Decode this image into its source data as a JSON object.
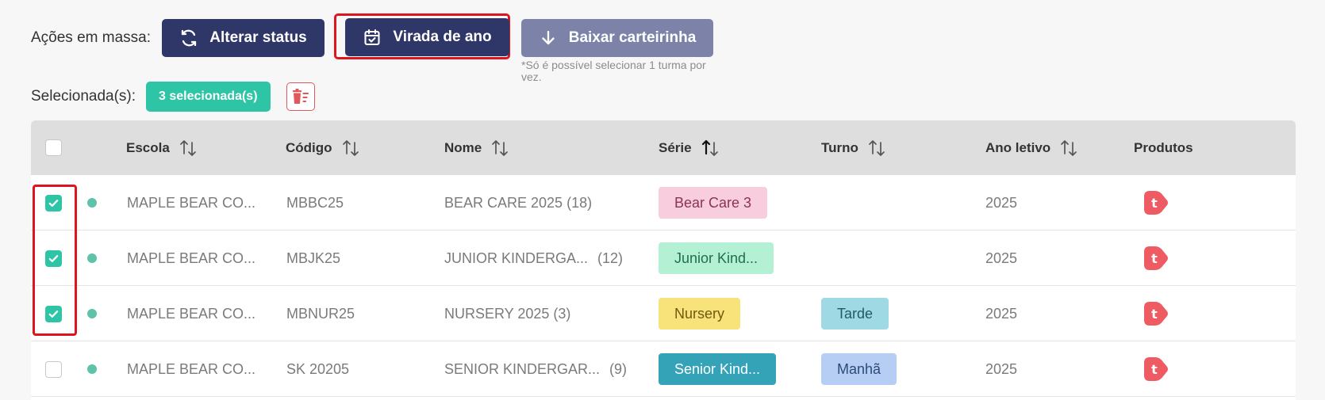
{
  "actions": {
    "label": "Ações em massa:",
    "buttons": {
      "alterar_status": "Alterar status",
      "virada_de_ano": "Virada de ano",
      "baixar_carteirinha": "Baixar carteirinha"
    },
    "note": "*Só é possível selecionar 1 turma por vez."
  },
  "selection": {
    "label": "Selecionada(s):",
    "badge": "3 selecionada(s)"
  },
  "table": {
    "headers": {
      "escola": "Escola",
      "codigo": "Código",
      "nome": "Nome",
      "serie": "Série",
      "turno": "Turno",
      "ano_letivo": "Ano letivo",
      "produtos": "Produtos"
    },
    "rows": [
      {
        "checked": true,
        "escola": "MAPLE BEAR CO...",
        "codigo": "MBBC25",
        "nome": "BEAR CARE 2025 (18)",
        "nome_count": "",
        "serie": "Bear Care 3",
        "turno": "",
        "ano": "2025"
      },
      {
        "checked": true,
        "escola": "MAPLE BEAR CO...",
        "codigo": "MBJK25",
        "nome": "JUNIOR KINDERGA...",
        "nome_count": "(12)",
        "serie": "Junior Kind...",
        "turno": "",
        "ano": "2025"
      },
      {
        "checked": true,
        "escola": "MAPLE BEAR CO...",
        "codigo": "MBNUR25",
        "nome": "NURSERY 2025 (3)",
        "nome_count": "",
        "serie": "Nursery",
        "turno": "Tarde",
        "ano": "2025"
      },
      {
        "checked": false,
        "escola": "MAPLE BEAR CO...",
        "codigo": "SK 20205",
        "nome": "SENIOR KINDERGAR...",
        "nome_count": "(9)",
        "serie": "Senior Kind...",
        "turno": "Manhã",
        "ano": "2025"
      }
    ],
    "product_icon": "t"
  },
  "colors": {
    "primary": "#2f3769",
    "muted": "#7d83a8",
    "accent": "#2ec4a6",
    "highlight": "#e0141e",
    "serie_bear_care": "#f8cede",
    "serie_junior": "#b3f0d4",
    "serie_nursery": "#f8e27a",
    "serie_senior": "#35a3b7",
    "turno_tarde": "#9ed9e4",
    "turno_manha": "#b6cef3",
    "product": "#ef5b63"
  }
}
